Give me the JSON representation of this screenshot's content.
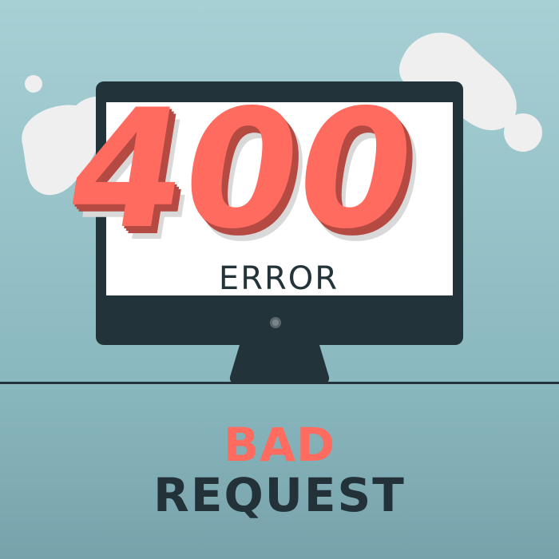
{
  "error": {
    "code": "400",
    "label": "ERROR"
  },
  "message": {
    "line1": "BAD",
    "line2": "REQUEST"
  },
  "colors": {
    "accent": "#ff6b5e",
    "accent_shadow": "#b54a42",
    "dark": "#233238",
    "bg_top": "#a6cfd4",
    "bg_bottom": "#79a3ac",
    "cloud": "#f0f0f0",
    "screen": "#ffffff"
  }
}
